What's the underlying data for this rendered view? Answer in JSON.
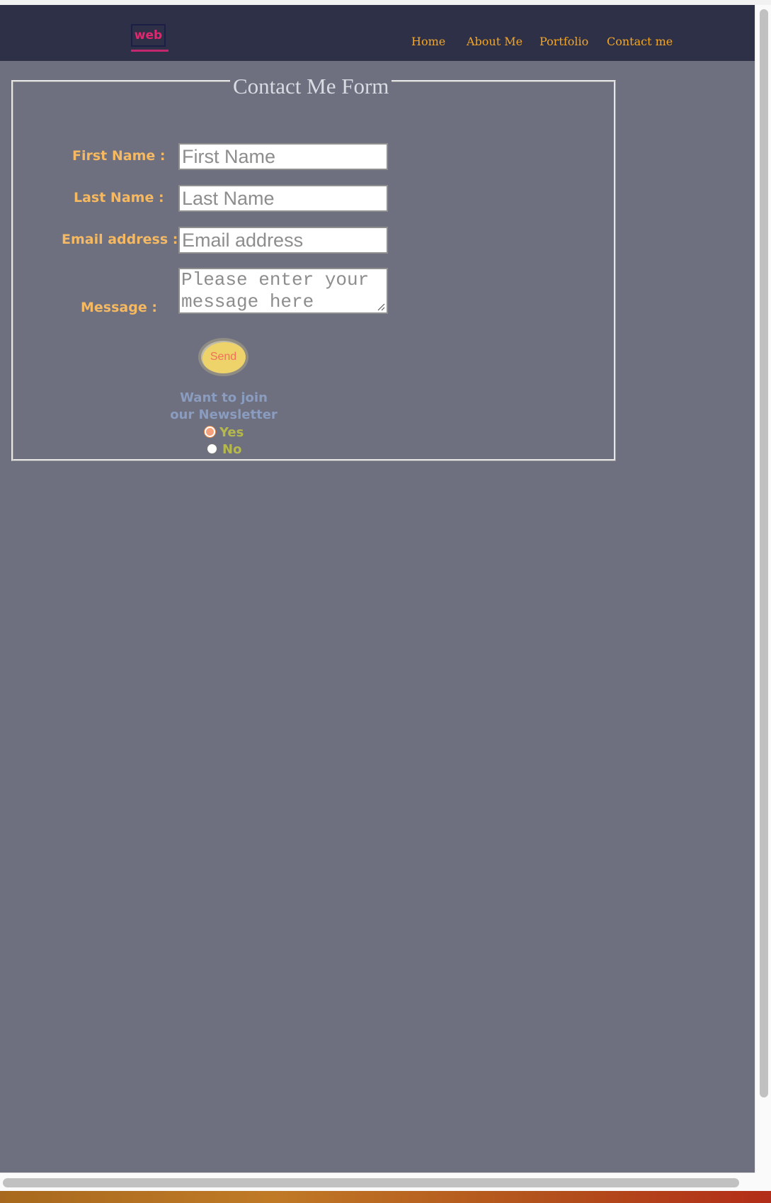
{
  "nav": {
    "logo_text": "web",
    "links": [
      "Home",
      "About Me",
      "Portfolio",
      "Contact me"
    ]
  },
  "form": {
    "legend": "Contact Me Form",
    "first_name": {
      "label": "First Name :",
      "placeholder": "First Name"
    },
    "last_name": {
      "label": "Last Name :",
      "placeholder": "Last Name"
    },
    "email": {
      "label": "Email address :",
      "placeholder": "Email address"
    },
    "message": {
      "label": "Message :",
      "placeholder": "Please enter your message here"
    },
    "send_label": "Send",
    "newsletter": {
      "question_line1": "Want to join",
      "question_line2": "our Newsletter",
      "yes_label": "Yes",
      "no_label": "No",
      "selected": "Yes"
    }
  },
  "colors": {
    "page_background": "#6e707f",
    "navbar": "#2d3047",
    "nav_link": "#f5a623",
    "logo": "#e5266f",
    "label": "#f4b962",
    "send_button": "#edd36a",
    "send_text": "#f0705a",
    "newsletter_question": "#8a9cbf",
    "radio_label": "#b5b84a"
  }
}
